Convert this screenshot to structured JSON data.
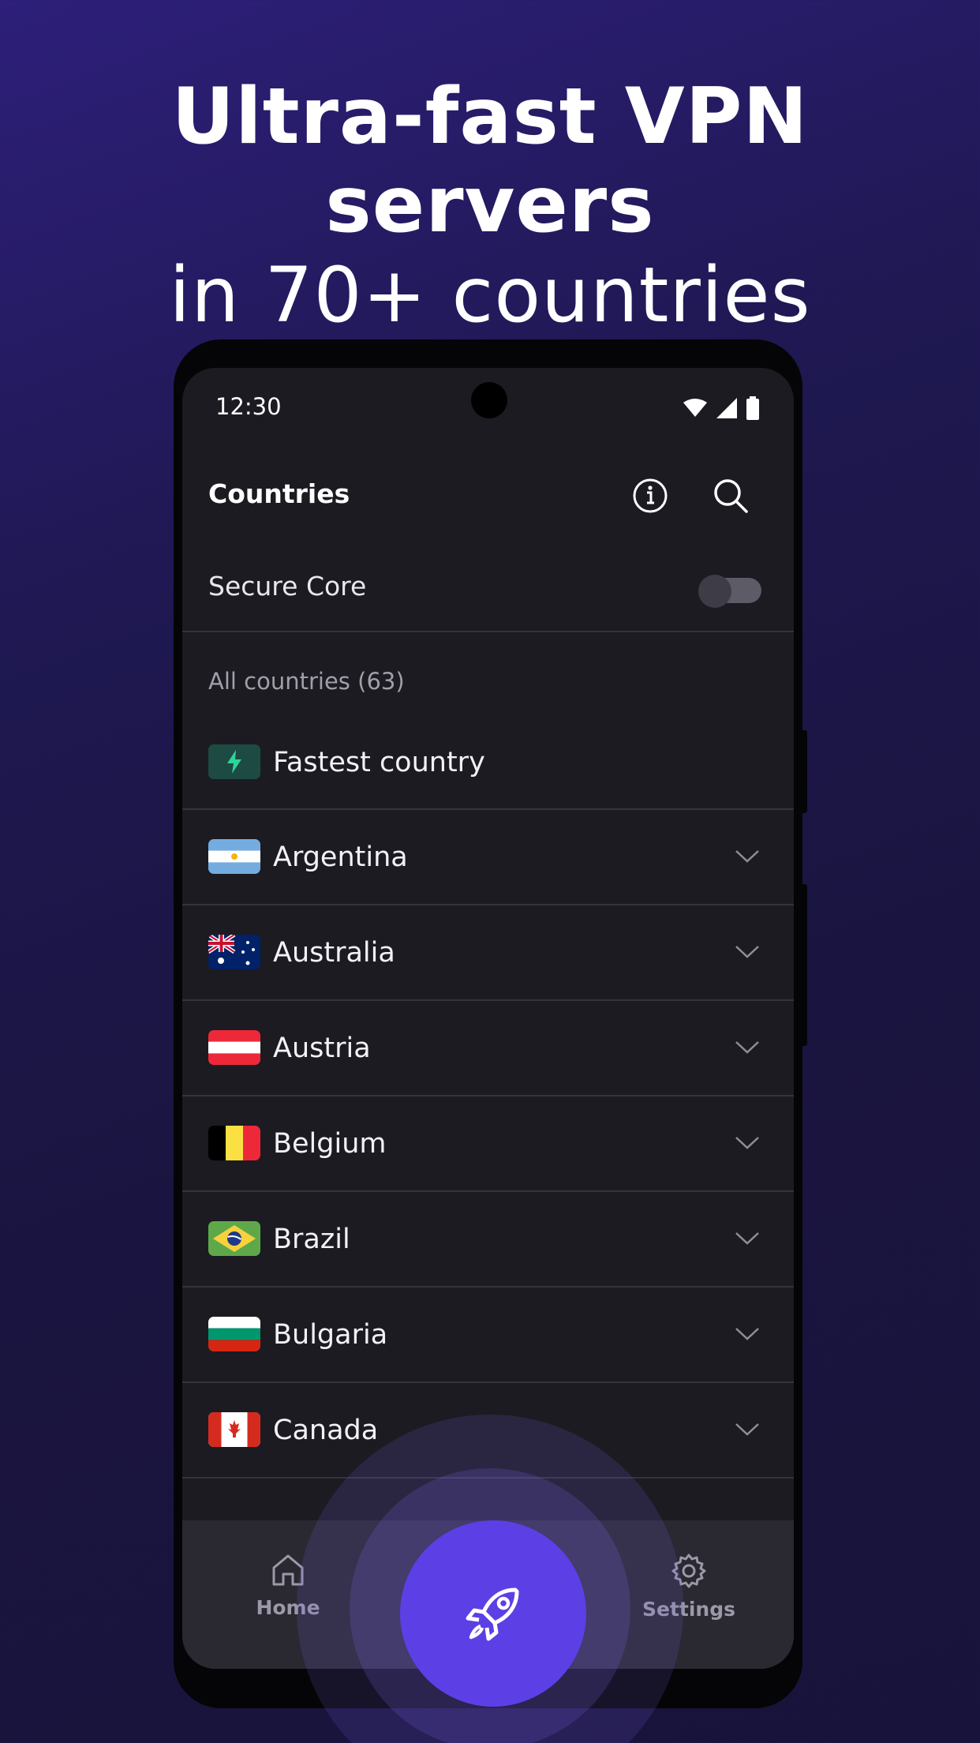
{
  "headline": {
    "line1": "Ultra-fast VPN servers",
    "line2": "in 70+ countries"
  },
  "status_bar": {
    "time": "12:30",
    "icons": [
      "wifi-icon",
      "signal-icon",
      "battery-icon"
    ]
  },
  "top_bar": {
    "title": "Countries",
    "actions": [
      "info-icon",
      "search-icon"
    ]
  },
  "secure_core": {
    "label": "Secure Core",
    "enabled": false
  },
  "section_label": "All countries (63)",
  "fastest": {
    "label": "Fastest country",
    "icon": "lightning-icon",
    "accent": "#2fd49b"
  },
  "countries": [
    {
      "name": "Argentina",
      "flag": "flag-argentina"
    },
    {
      "name": "Australia",
      "flag": "flag-australia"
    },
    {
      "name": "Austria",
      "flag": "flag-austria"
    },
    {
      "name": "Belgium",
      "flag": "flag-belgium"
    },
    {
      "name": "Brazil",
      "flag": "flag-brazil"
    },
    {
      "name": "Bulgaria",
      "flag": "flag-bulgaria"
    },
    {
      "name": "Canada",
      "flag": "flag-canada"
    }
  ],
  "bottom_nav": {
    "home_label": "Home",
    "settings_label": "Settings",
    "connect_icon": "rocket-icon"
  },
  "colors": {
    "background": "#1f1852",
    "screen": "#1c1b22",
    "connect_button": "#5d3fe6",
    "divider": "#35343c"
  }
}
